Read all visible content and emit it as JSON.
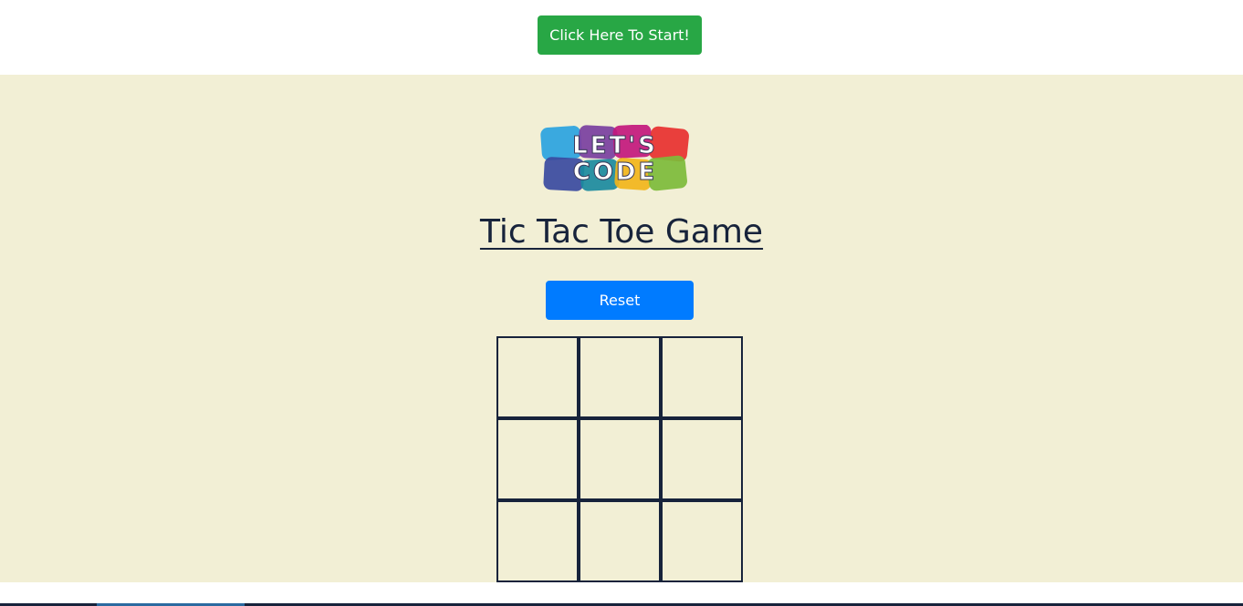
{
  "header": {
    "start_label": "Click Here To Start!"
  },
  "logo": {
    "line1": "LET'S",
    "line2": "CODE",
    "tile_colors": [
      "#2aa3e0",
      "#7a3fa0",
      "#c3187d",
      "#e8302f",
      "#3a4aa0",
      "#1b8a9e",
      "#f2b51b",
      "#7dbb3a"
    ]
  },
  "game": {
    "title": "Tic Tac Toe Game",
    "reset_label": "Reset",
    "board": [
      [
        "",
        "",
        ""
      ],
      [
        "",
        "",
        ""
      ],
      [
        "",
        "",
        ""
      ]
    ]
  },
  "colors": {
    "start_button": "#28a745",
    "reset_button": "#007bff",
    "panel_background": "#f2efd5",
    "grid_lines": "#17233b"
  }
}
